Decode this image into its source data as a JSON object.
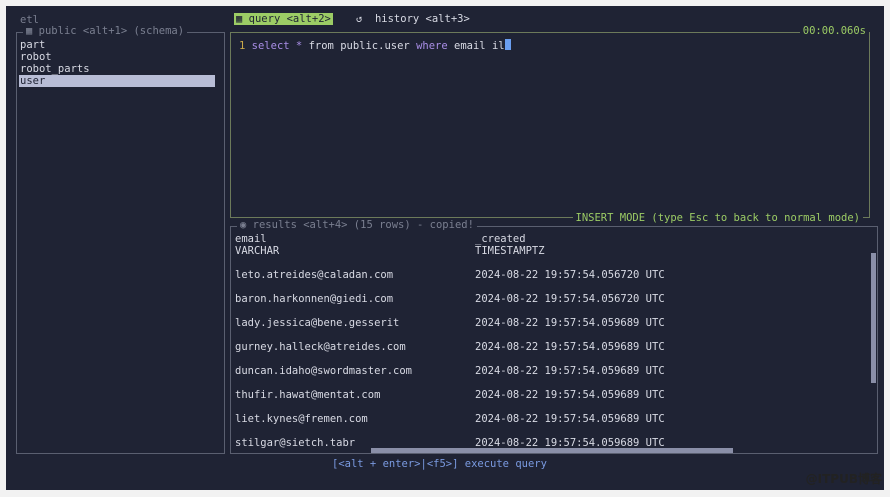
{
  "app": {
    "db_name": "etl"
  },
  "sidebar": {
    "title": "public <alt+1> (schema)",
    "icon": "table-icon",
    "items": [
      "part",
      "robot",
      "robot_parts",
      "user"
    ],
    "selected": "user"
  },
  "tabs": [
    {
      "label": "query <alt+2>",
      "icon": "table-icon",
      "active": true
    },
    {
      "label": "history <alt+3>",
      "icon": "history-icon",
      "active": false
    }
  ],
  "editor": {
    "timer": "00:00.060s",
    "line_number": "1",
    "query": {
      "kw1": "select",
      "star": "*",
      "from": "from",
      "table": "public.user",
      "where": "where",
      "rest": "email il"
    },
    "mode": "INSERT MODE (type Esc to back to normal mode)"
  },
  "results": {
    "title": "results <alt+4> (15 rows) - copied!",
    "columns": [
      {
        "name": "email",
        "type": "VARCHAR"
      },
      {
        "name": "_created",
        "type": "TIMESTAMPTZ"
      }
    ],
    "rows": [
      [
        "leto.atreides@caladan.com",
        "2024-08-22 19:57:54.056720 UTC"
      ],
      [
        "baron.harkonnen@giedi.com",
        "2024-08-22 19:57:54.056720 UTC"
      ],
      [
        "lady.jessica@bene.gesserit",
        "2024-08-22 19:57:54.059689 UTC"
      ],
      [
        "gurney.halleck@atreides.com",
        "2024-08-22 19:57:54.059689 UTC"
      ],
      [
        "duncan.idaho@swordmaster.com",
        "2024-08-22 19:57:54.059689 UTC"
      ],
      [
        "thufir.hawat@mentat.com",
        "2024-08-22 19:57:54.059689 UTC"
      ],
      [
        "liet.kynes@fremen.com",
        "2024-08-22 19:57:54.059689 UTC"
      ],
      [
        "stilgar@sietch.tabr",
        "2024-08-22 19:57:54.059689 UTC"
      ]
    ]
  },
  "footer": {
    "hint": "[<alt + enter>|<f5>] execute query"
  },
  "watermark": "@ITPUB博客",
  "colors": {
    "accent": "#9ccc65",
    "keyword": "#a98ee6",
    "selection": "#b8bdd6",
    "bg": "#1f2334"
  }
}
